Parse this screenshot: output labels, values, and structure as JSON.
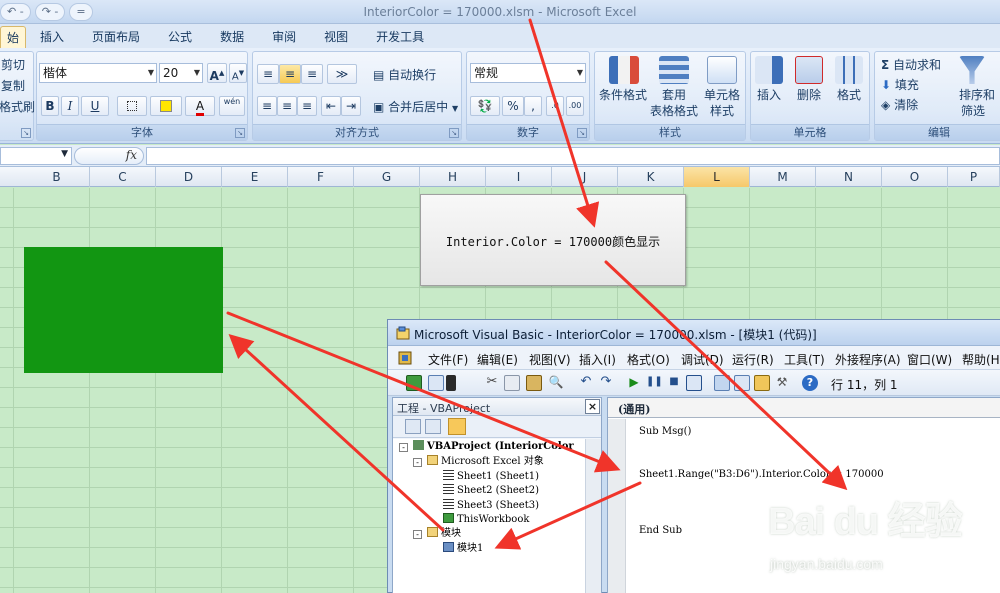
{
  "window": {
    "title": "InteriorColor = 170000.xlsm - Microsoft Excel"
  },
  "qat": {
    "undo": "↶ -",
    "redo": "↷ -",
    "more": "="
  },
  "tabs": [
    {
      "label": "始",
      "active": true
    },
    {
      "label": "插入"
    },
    {
      "label": "页面布局"
    },
    {
      "label": "公式"
    },
    {
      "label": "数据"
    },
    {
      "label": "审阅"
    },
    {
      "label": "视图"
    },
    {
      "label": "开发工具"
    }
  ],
  "ribbon": {
    "clipboard": {
      "cut": "剪切",
      "copy": "复制",
      "painter": "格式刷"
    },
    "font": {
      "name": "楷体",
      "size": "20",
      "label": "字体",
      "grow": "A",
      "shrink": "A",
      "bold": "B",
      "italic": "I",
      "underline": "U",
      "wen": "wén"
    },
    "alignment": {
      "wrap": "自动换行",
      "merge": "合并后居中",
      "label": "对齐方式"
    },
    "number": {
      "format": "常规",
      "percent": "%",
      "comma": ",",
      "label": "数字"
    },
    "styles": {
      "conditional": "条件格式",
      "table_1": "套用",
      "table_2": "表格格式",
      "cell_1": "单元格",
      "cell_2": "样式",
      "label": "样式"
    },
    "cells": {
      "insert": "插入",
      "delete": "删除",
      "format": "格式",
      "label": "单元格"
    },
    "editing": {
      "autosum": "自动求和",
      "fill": "填充",
      "clear": "清除",
      "sort_1": "排序和",
      "sort_2": "筛选",
      "label": "编辑"
    }
  },
  "formula_bar": {
    "fx": "fx"
  },
  "columns": [
    "B",
    "C",
    "D",
    "E",
    "F",
    "G",
    "H",
    "I",
    "J",
    "K",
    "L",
    "M",
    "N",
    "O",
    "P"
  ],
  "active_column": "L",
  "colors": {
    "range_fill": "#129612"
  },
  "callout": {
    "text": "Interior.Color = 170000颜色显示"
  },
  "vba": {
    "title": "Microsoft Visual Basic - InteriorColor = 170000.xlsm - [模块1 (代码)]",
    "menu": [
      "文件(F)",
      "编辑(E)",
      "视图(V)",
      "插入(I)",
      "格式(O)",
      "调试(D)",
      "运行(R)",
      "工具(T)",
      "外接程序(A)",
      "窗口(W)",
      "帮助(H)"
    ],
    "cursor_pos": "行 11，列 1",
    "project_title": "工程 - VBAProject",
    "tree": {
      "project": "VBAProject (InteriorColor",
      "excel_objects": "Microsoft Excel 对象",
      "sheet1": "Sheet1 (Sheet1)",
      "sheet2": "Sheet2 (Sheet2)",
      "sheet3": "Sheet3 (Sheet3)",
      "workbook": "ThisWorkbook",
      "modules": "模块",
      "module1": "模块1"
    },
    "code_header": "(通用)",
    "code": [
      "Sub Msg()",
      "Sheet1.Range(\"B3:D6\").Interior.Color = 170000",
      "End Sub"
    ]
  },
  "watermark": {
    "brand": "Bai du 经验",
    "url": "jingyan.baidu.com"
  }
}
